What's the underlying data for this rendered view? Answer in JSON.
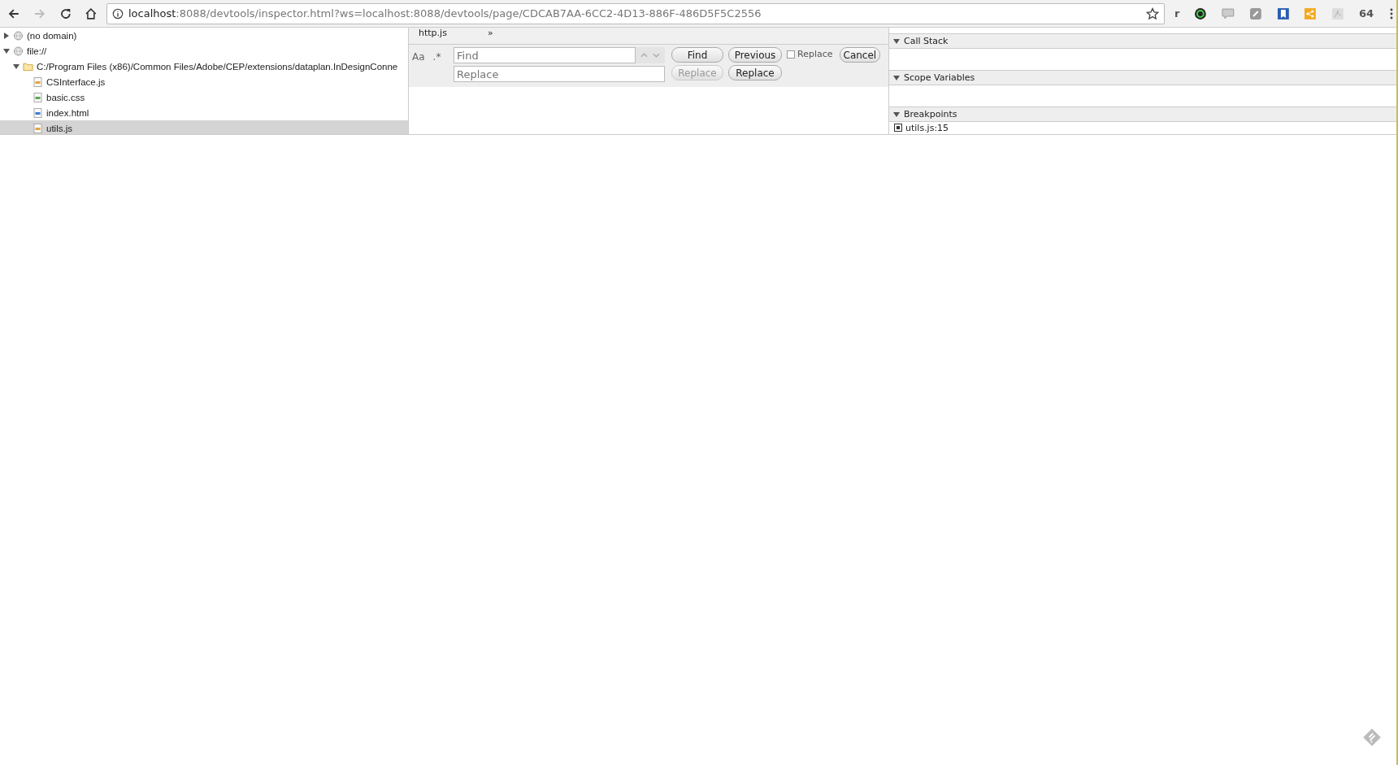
{
  "toolbar": {
    "url_host": "localhost",
    "url_rest": ":8088/devtools/inspector.html?ws=localhost:8088/devtools/page/CDCAB7AA-6CC2-4D13-886F-486D5F5C2556",
    "extensions": [
      {
        "kind": "letter",
        "text": "r"
      },
      {
        "kind": "ring"
      },
      {
        "kind": "chat"
      },
      {
        "kind": "square"
      },
      {
        "kind": "bookmark"
      },
      {
        "kind": "share"
      },
      {
        "kind": "pdf"
      },
      {
        "kind": "letter",
        "text": "64"
      }
    ]
  },
  "tree": [
    {
      "label": "(no domain)",
      "kind": "domain",
      "expanded": false,
      "selected": false
    },
    {
      "label": "file://",
      "kind": "domain",
      "expanded": true,
      "selected": false,
      "children": [
        {
          "label": "C:/Program Files (x86)/Common Files/Adobe/CEP/extensions/dataplan.InDesignConne",
          "kind": "folder",
          "expanded": true,
          "selected": false,
          "children": [
            {
              "label": "CSInterface.js",
              "kind": "js",
              "selected": false
            },
            {
              "label": "basic.css",
              "kind": "css",
              "selected": false
            },
            {
              "label": "index.html",
              "kind": "html",
              "selected": false
            },
            {
              "label": "utils.js",
              "kind": "js",
              "selected": true
            }
          ]
        }
      ]
    }
  ],
  "editor": {
    "tab": "http.js",
    "more": "»",
    "case_toggle": "Aa",
    "regex_toggle": ".*",
    "find": {
      "placeholder": "Find"
    },
    "replace": {
      "placeholder": "Replace"
    },
    "buttons": [
      {
        "label": "Find",
        "disabled": false
      },
      {
        "label": "Previous",
        "disabled": false
      },
      {
        "label": "Replace",
        "disabled": true
      },
      {
        "label": "Replace",
        "disabled": false
      }
    ],
    "replace_option": {
      "label": "Replace",
      "checked": false
    },
    "cancel": "Cancel"
  },
  "sidebar": {
    "sections": [
      {
        "title": "Call Stack",
        "expanded": true
      },
      {
        "title": "Scope Variables",
        "expanded": true
      },
      {
        "title": "Breakpoints",
        "expanded": true,
        "items": [
          {
            "label": "utils.js:15",
            "checked": true
          }
        ]
      }
    ]
  }
}
